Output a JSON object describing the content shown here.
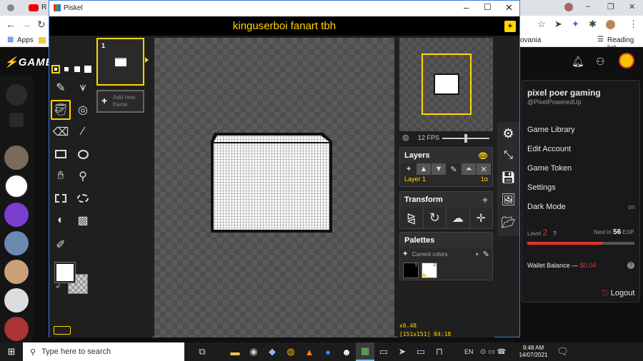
{
  "browser": {
    "tab_label": "R",
    "bookmarks_apps": "Apps",
    "bookmark_partial": "ovania",
    "reading_list": "Reading list"
  },
  "site": {
    "logo_text": "GAME",
    "profile": {
      "name": "pixel poer gaming",
      "handle": "@PixelPoweredUp",
      "menu": [
        "Game Library",
        "Edit Account",
        "Game Token",
        "Settings"
      ],
      "dark_mode_label": "Dark Mode",
      "dark_mode_value": "on",
      "level_label": "Level",
      "level_value": "2",
      "level_help": "?",
      "next_label": "Next in",
      "next_value": "56",
      "exp_label": "EXP",
      "exp_bar_fraction": 0.7,
      "wallet_label": "Wallet Balance —",
      "wallet_value": "$0.04",
      "logout_label": "Logout",
      "accent_color": "#e5342a"
    }
  },
  "piskel": {
    "window_title": "Piskel",
    "doc_title": "kinguserboi fanart tbh",
    "frame_number": "1",
    "add_frame_label_1": "Add new",
    "add_frame_label_2": "frame",
    "fps_label": "12 FPS",
    "fps_fraction": 0.5,
    "layers_title": "Layers",
    "layer_name": "Layer 1",
    "layer_alpha": "1α",
    "transform_title": "Transform",
    "palettes_title": "Palettes",
    "palette_select": "Current colors",
    "swatch_1_index": "1",
    "swatch_2_index": "2",
    "zoom_readout": "x6.48",
    "size_readout": "[151x151] 84:18",
    "accent_color": "#ffd700"
  },
  "taskbar": {
    "search_placeholder": "Type here to search",
    "language": "EN",
    "time": "9:48 AM",
    "date": "14/07/2021"
  }
}
